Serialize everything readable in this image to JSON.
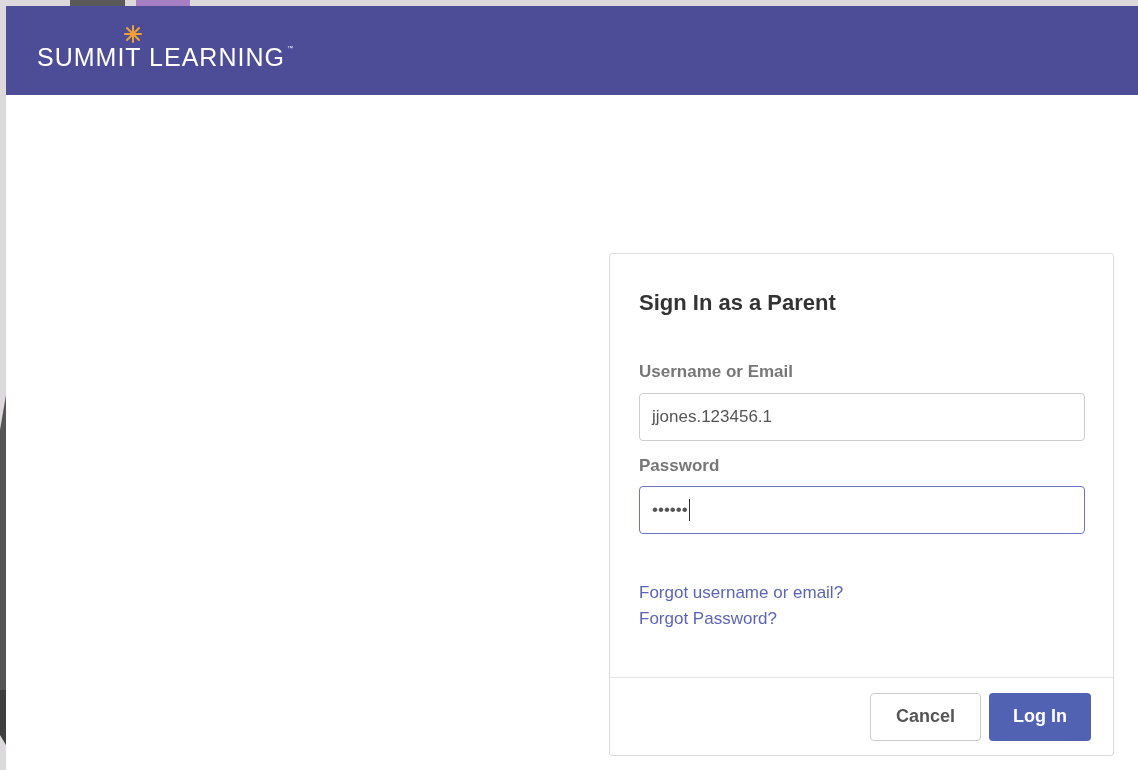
{
  "header": {
    "logo": "SUMMIT LEARNING",
    "trademark": "™"
  },
  "dialog": {
    "title": "Sign In as a Parent",
    "fields": [
      {
        "label": "Username or Email",
        "value": "jjones.123456.1",
        "focused": false
      },
      {
        "label": "Password",
        "value": "••••••",
        "focused": true
      }
    ],
    "links": [
      "Forgot username or email?",
      "Forgot Password?"
    ],
    "buttons": [
      {
        "label": "Cancel",
        "kind": "secondary"
      },
      {
        "label": "Log In",
        "kind": "primary"
      }
    ]
  }
}
